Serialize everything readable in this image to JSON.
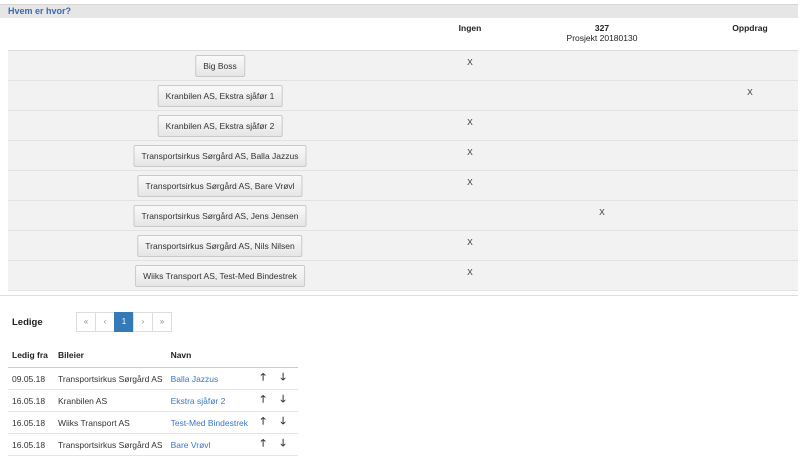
{
  "section": {
    "title": "Hvem er hvor?"
  },
  "columns": [
    {
      "title": "Ingen",
      "subtitle": ""
    },
    {
      "title": "327",
      "subtitle": "Prosjekt 20180130"
    },
    {
      "title": "Oppdrag",
      "subtitle": ""
    }
  ],
  "rows": [
    {
      "label": "Big Boss",
      "marks": [
        "X",
        "",
        ""
      ]
    },
    {
      "label": "Kranbilen AS, Ekstra sjåfør 1",
      "marks": [
        "",
        "",
        "X"
      ]
    },
    {
      "label": "Kranbilen AS, Ekstra sjåfør 2",
      "marks": [
        "X",
        "",
        ""
      ]
    },
    {
      "label": "Transportsirkus Sørgård AS, Balla Jazzus",
      "marks": [
        "X",
        "",
        ""
      ]
    },
    {
      "label": "Transportsirkus Sørgård AS, Bare Vrøvl",
      "marks": [
        "X",
        "",
        ""
      ]
    },
    {
      "label": "Transportsirkus Sørgård AS, Jens Jensen",
      "marks": [
        "",
        "X",
        ""
      ]
    },
    {
      "label": "Transportsirkus Sørgård AS, Nils Nilsen",
      "marks": [
        "X",
        "",
        ""
      ]
    },
    {
      "label": "Wiiks Transport AS, Test-Med Bindestrek",
      "marks": [
        "X",
        "",
        ""
      ]
    }
  ],
  "ledige": {
    "title": "Ledige",
    "pager": {
      "first": "«",
      "prev": "‹",
      "current": "1",
      "next": "›",
      "last": "»"
    },
    "headers": {
      "date": "Ledig fra",
      "owner": "Bileier",
      "name": "Navn"
    },
    "arrow_up": "🡑",
    "arrow_down": "🡓",
    "items": [
      {
        "date": "09.05.18",
        "owner": "Transportsirkus Sørgård AS",
        "name": "Balla Jazzus"
      },
      {
        "date": "16.05.18",
        "owner": "Kranbilen AS",
        "name": "Ekstra sjåfør 2"
      },
      {
        "date": "16.05.18",
        "owner": "Wiiks Transport AS",
        "name": "Test-Med Bindestrek"
      },
      {
        "date": "16.05.18",
        "owner": "Transportsirkus Sørgård AS",
        "name": "Bare Vrøvl"
      }
    ]
  }
}
